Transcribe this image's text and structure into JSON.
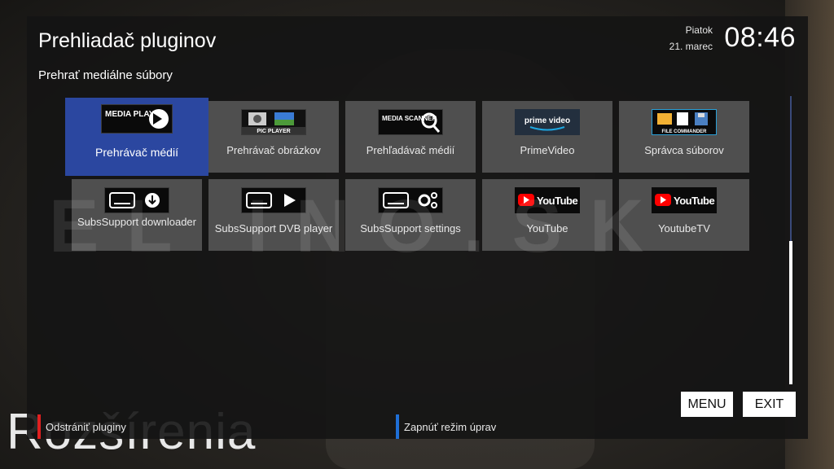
{
  "header": {
    "title": "Prehliadač pluginov",
    "subtitle": "Prehrať mediálne súbory",
    "day": "Piatok",
    "date": "21. marec",
    "time": "08:46"
  },
  "watermark": "EL  INO.SK",
  "background_text": "Rozšírenia",
  "plugins": [
    {
      "label": "Prehrávač médií",
      "icon": "media-player-icon",
      "logo_text": "MEDIA PLAYER",
      "selected": true
    },
    {
      "label": "Prehrávač obrázkov",
      "icon": "pic-player-icon",
      "logo_text": "PIC PLAYER"
    },
    {
      "label": "Prehľadávač médií",
      "icon": "media-scanner-icon",
      "logo_text": "MEDIA SCANNER"
    },
    {
      "label": "PrimeVideo",
      "icon": "prime-video-icon",
      "logo_text": "prime video"
    },
    {
      "label": "Správca súborov",
      "icon": "file-commander-icon",
      "logo_text": "FILE COMMANDER"
    },
    {
      "label": "SubsSupport downloader",
      "icon": "subs-download-icon",
      "logo_text": ""
    },
    {
      "label": "SubsSupport DVB player",
      "icon": "subs-play-icon",
      "logo_text": ""
    },
    {
      "label": "SubsSupport settings",
      "icon": "subs-settings-icon",
      "logo_text": ""
    },
    {
      "label": "YouTube",
      "icon": "youtube-icon",
      "logo_text": "YouTube"
    },
    {
      "label": "YoutubeTV",
      "icon": "youtube-icon",
      "logo_text": "YouTube"
    }
  ],
  "buttons": {
    "menu": "MENU",
    "exit": "EXIT"
  },
  "color_keys": {
    "red": "Odstrániť pluginy",
    "blue": "Zapnúť režim úprav"
  },
  "colors": {
    "selection": "#2b47a0",
    "red_key": "#e02020",
    "blue_key": "#1f6fd6",
    "youtube_red": "#ff0000"
  }
}
